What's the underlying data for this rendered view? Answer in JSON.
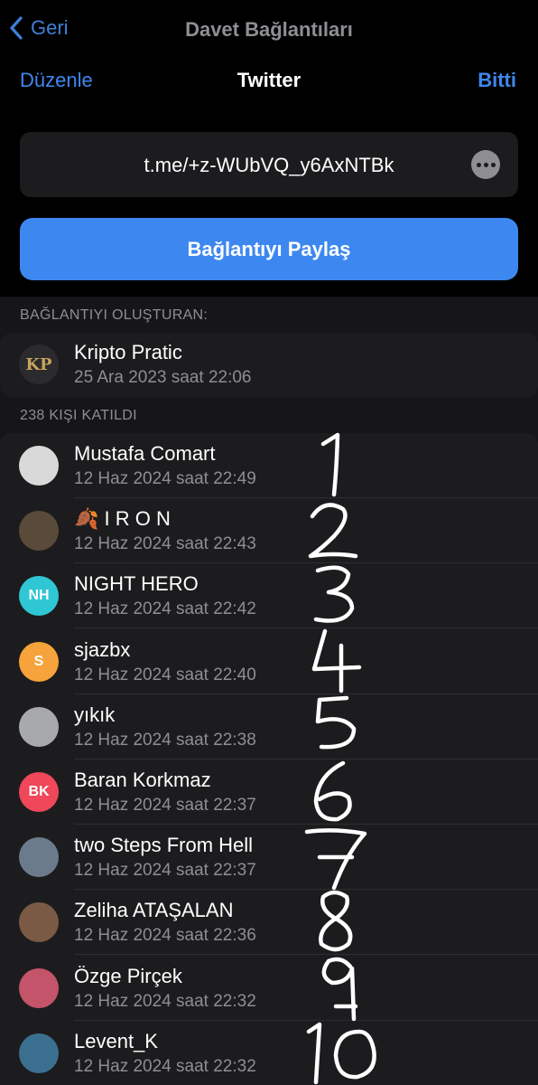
{
  "nav": {
    "back_label": "Geri",
    "title": "Davet Bağlantıları"
  },
  "header": {
    "edit_label": "Düzenle",
    "title": "Twitter",
    "done_label": "Bitti"
  },
  "invite_link": {
    "url": "t.me/+z-WUbVQ_y6AxNTBk",
    "more_icon": "ellipsis-icon"
  },
  "share_button_label": "Bağlantıyı Paylaş",
  "creator_section": {
    "header": "BAĞLANTIYI OLUŞTURAN:",
    "name": "Kripto Pratic",
    "date": "25 Ara 2023 saat 22:06",
    "avatar_initials": "KP",
    "avatar_color": "#2b2b2d"
  },
  "joined_section": {
    "header": "238 KIŞI KATILDI",
    "members": [
      {
        "name": "Mustafa Comart",
        "date": "12 Haz 2024 saat 22:49",
        "initials": "",
        "color": "#d9d9d9",
        "annotation": "1"
      },
      {
        "name": "🍂 I R O N",
        "date": "12 Haz 2024 saat 22:43",
        "initials": "",
        "color": "#5a4a3a",
        "annotation": "2"
      },
      {
        "name": "NIGHT HERO",
        "date": "12 Haz 2024 saat 22:42",
        "initials": "NH",
        "color": "#2fc7d3",
        "annotation": "3"
      },
      {
        "name": "sjazbx",
        "date": "12 Haz 2024 saat 22:40",
        "initials": "S",
        "color": "#f5a33a",
        "annotation": "4"
      },
      {
        "name": "yıkık",
        "date": "12 Haz 2024 saat 22:38",
        "initials": "",
        "color": "#a7a9ab",
        "annotation": "5"
      },
      {
        "name": "Baran Korkmaz",
        "date": "12 Haz 2024 saat 22:37",
        "initials": "BK",
        "color": "#f0475a",
        "annotation": "6"
      },
      {
        "name": "two Steps From Hell",
        "date": "12 Haz 2024 saat 22:37",
        "initials": "",
        "color": "#6b7b8c",
        "annotation": "7"
      },
      {
        "name": "Zeliha ATAŞALAN",
        "date": "12 Haz 2024 saat 22:36",
        "initials": "",
        "color": "#7a5a44",
        "annotation": "8"
      },
      {
        "name": "Özge Pirçek",
        "date": "12 Haz 2024 saat 22:32",
        "initials": "",
        "color": "#c4546a",
        "annotation": "9"
      },
      {
        "name": "Levent_K",
        "date": "12 Haz 2024 saat 22:32",
        "initials": "",
        "color": "#3b6f8f",
        "annotation": "10"
      }
    ]
  }
}
